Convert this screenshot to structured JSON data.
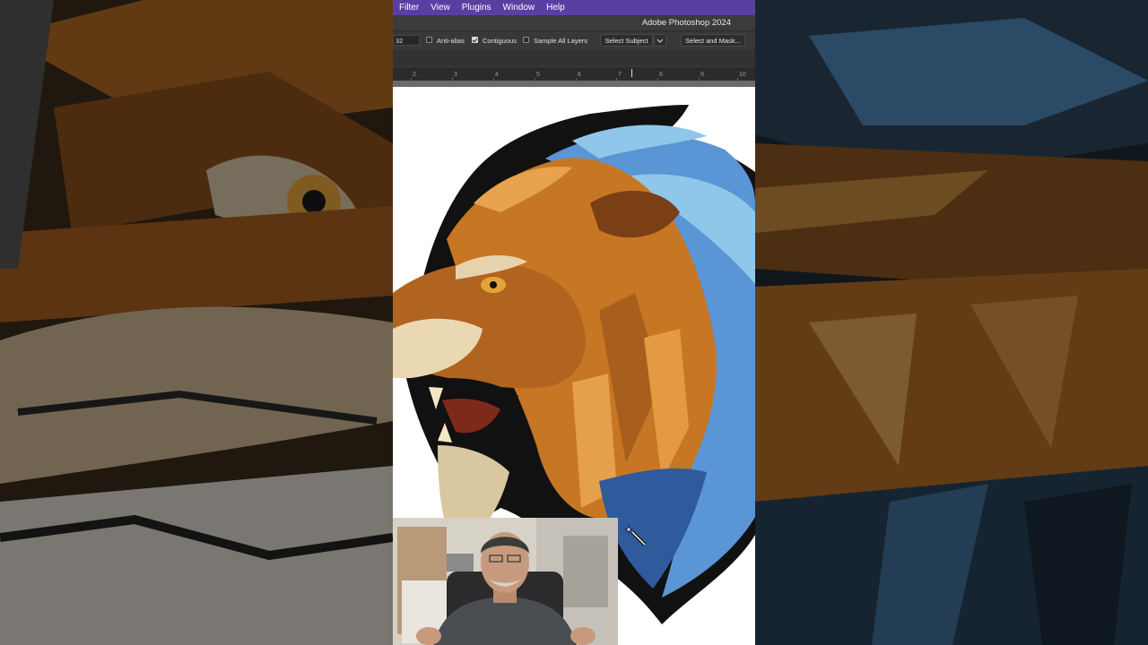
{
  "app": {
    "title": "Adobe Photoshop 2024"
  },
  "menu": {
    "items": [
      "Filter",
      "View",
      "Plugins",
      "Window",
      "Help"
    ]
  },
  "options": {
    "tolerance_value": "32",
    "anti_alias_label": "Anti-alias",
    "anti_alias_checked": false,
    "contiguous_label": "Contiguous",
    "contiguous_checked": true,
    "sample_all_layers_label": "Sample All Layers",
    "sample_all_layers_checked": false,
    "select_subject_label": "Select Subject",
    "select_and_mask_label": "Select and Mask..."
  },
  "ruler": {
    "numbers": [
      "2",
      "3",
      "4",
      "5",
      "6",
      "7",
      "8",
      "9",
      "10"
    ]
  },
  "icons": {
    "dropdown": "chevron-down-icon",
    "tool": "magic-wand-icon"
  },
  "colors": {
    "menubar": "#5a3fa3",
    "panel": "#383838",
    "mane_orange": "#d5862e",
    "mane_blue": "#5a95d6",
    "light_blue": "#8fc7ea"
  }
}
